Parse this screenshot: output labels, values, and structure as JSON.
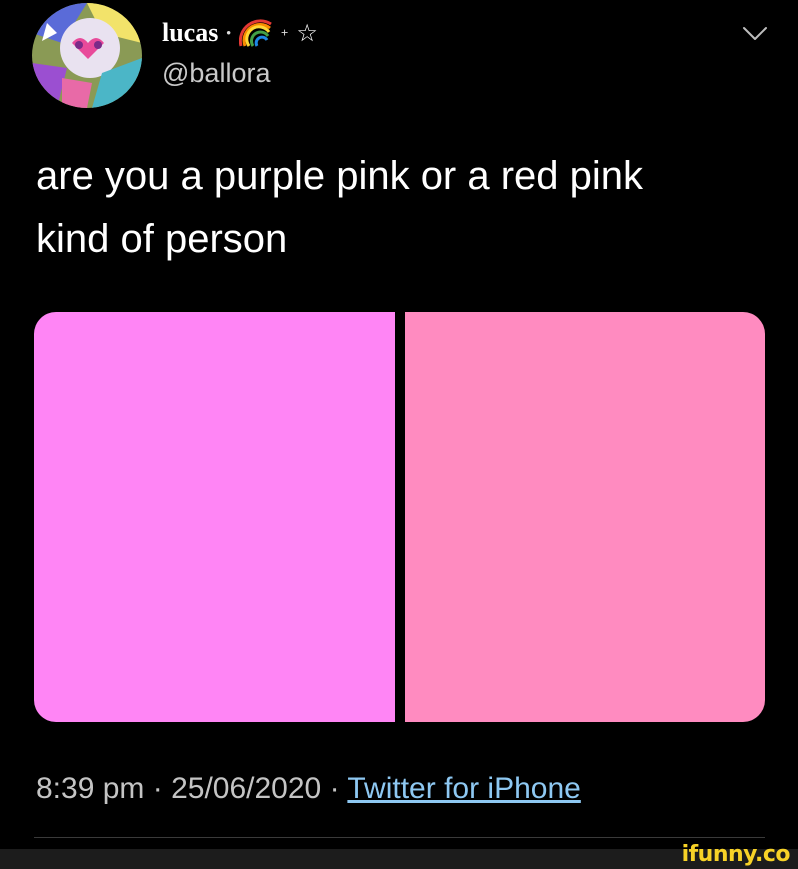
{
  "tweet": {
    "display_name": "lucas",
    "name_decoration_left": "•",
    "name_decoration_right": "+",
    "name_emoji_icon": "rainbow-icon",
    "name_star": "☆",
    "handle": "@ballora",
    "text": "are you a purple pink or a red pink\nkind of person",
    "media": {
      "left_color": "#ff85f5",
      "right_color": "#ff8bc0"
    },
    "time": "8:39 pm",
    "separator": "·",
    "date": "25/06/2020",
    "source": "Twitter for iPhone"
  },
  "icons": {
    "menu": "chevron-down-icon",
    "avatar": "avatar"
  },
  "watermark": "ifunny.co",
  "colors": {
    "background": "#000000",
    "handle": "#c9c9c9",
    "link": "#8ec8f2",
    "watermark": "#f7d227"
  }
}
